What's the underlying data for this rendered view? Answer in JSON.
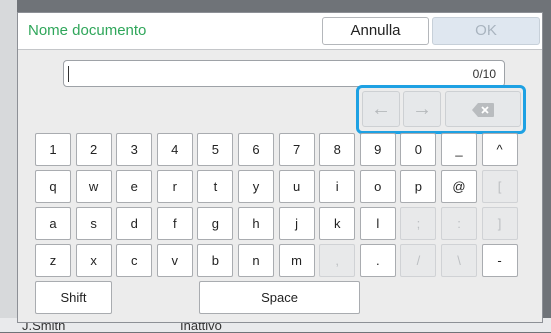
{
  "dialog": {
    "title": "Nome documento",
    "cancel_label": "Annulla",
    "ok_label": "OK",
    "counter": "0/10"
  },
  "nav": {
    "left_label": "←",
    "right_label": "→"
  },
  "keys": {
    "row1": [
      "1",
      "2",
      "3",
      "4",
      "5",
      "6",
      "7",
      "8",
      "9",
      "0",
      "_",
      "^"
    ],
    "row2": [
      "q",
      "w",
      "e",
      "r",
      "t",
      "y",
      "u",
      "i",
      "o",
      "p",
      "@",
      "["
    ],
    "row3": [
      "a",
      "s",
      "d",
      "f",
      "g",
      "h",
      "j",
      "k",
      "l",
      ";",
      ":",
      "]"
    ],
    "row4": [
      "z",
      "x",
      "c",
      "v",
      "b",
      "n",
      "m",
      ",",
      ".",
      "/",
      "\\",
      "-"
    ]
  },
  "shift_label": "Shift",
  "space_label": "Space",
  "background": {
    "user_text": "J.Smith",
    "status_text": "Inattivo"
  },
  "colors": {
    "title_green": "#2fa65a",
    "highlight_blue": "#1ea1e3"
  }
}
